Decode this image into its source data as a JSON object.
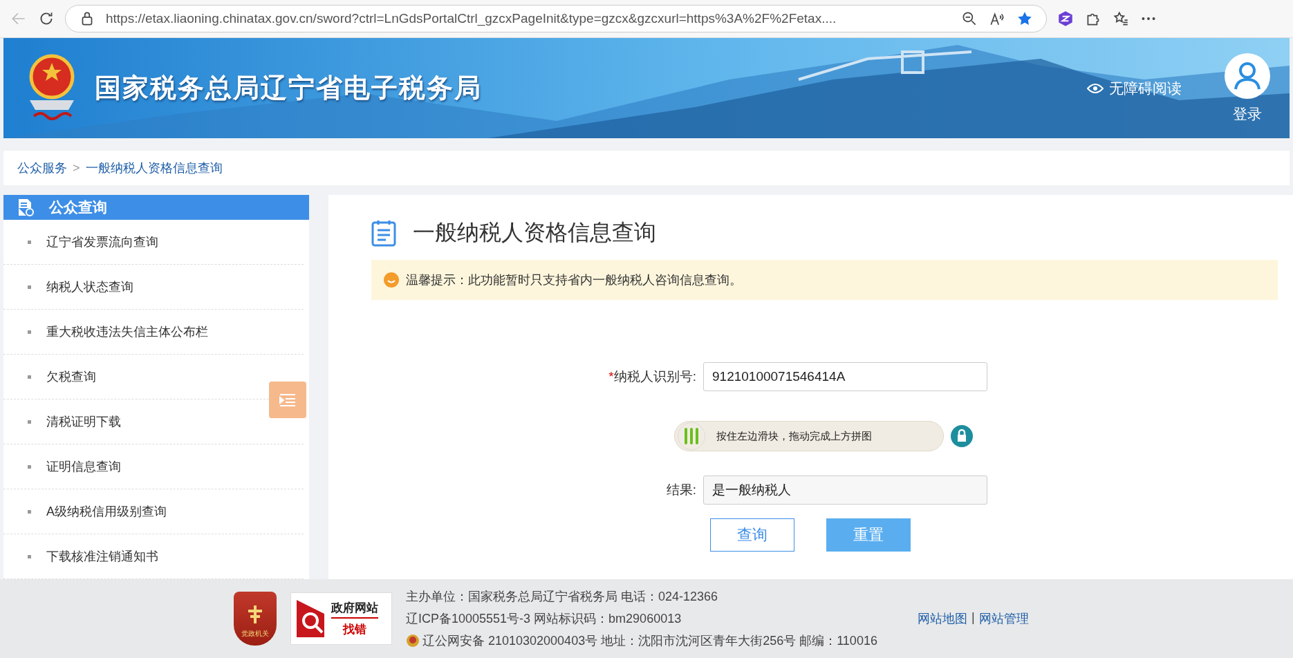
{
  "browser": {
    "url": "https://etax.liaoning.chinatax.gov.cn/sword?ctrl=LnGdsPortalCtrl_gzcxPageInit&type=gzcx&gzcxurl=https%3A%2F%2Fetax...."
  },
  "header": {
    "title": "国家税务总局辽宁省电子税务局",
    "accessibility": "无障碍阅读",
    "login": "登录"
  },
  "breadcrumb": [
    {
      "label": "公众服务",
      "kind": "link"
    },
    {
      "label": ">",
      "kind": "separator"
    },
    {
      "label": "一般纳税人资格信息查询",
      "kind": "current"
    }
  ],
  "sidebar": {
    "title": "公众查询",
    "items": [
      {
        "label": "辽宁省发票流向查询"
      },
      {
        "label": "纳税人状态查询"
      },
      {
        "label": "重大税收违法失信主体公布栏"
      },
      {
        "label": "欠税查询"
      },
      {
        "label": "清税证明下载"
      },
      {
        "label": "证明信息查询"
      },
      {
        "label": "A级纳税信用级别查询"
      },
      {
        "label": "下载核准注销通知书"
      }
    ]
  },
  "panel": {
    "title": "一般纳税人资格信息查询",
    "notice": "温馨提示：此功能暂时只支持省内一般纳税人咨询信息查询。",
    "fields": [
      {
        "kind": "input",
        "marker": "*",
        "label": "纳税人识别号:",
        "value": "91210100071546414A"
      },
      {
        "kind": "slider",
        "label": "按住左边滑块，拖动完成上方拼图"
      },
      {
        "kind": "result",
        "label": "结果:",
        "value": "是一般纳税人"
      }
    ],
    "buttons": [
      {
        "label": "查询",
        "kind": "outline"
      },
      {
        "label": "重置",
        "kind": "primary"
      }
    ]
  },
  "footer": {
    "badge": "党政机关",
    "report": {
      "top": "政府网站",
      "bottom": "找错"
    },
    "lines": [
      "主办单位：国家税务总局辽宁省税务局 电话：024-12366",
      "辽ICP备10005551号-3 网站标识码：bm29060013",
      "辽公网安备 21010302000403号 地址：沈阳市沈河区青年大街256号 邮编：110016"
    ],
    "links": [
      "网站地图",
      "网站管理"
    ],
    "link_separator": "|"
  }
}
